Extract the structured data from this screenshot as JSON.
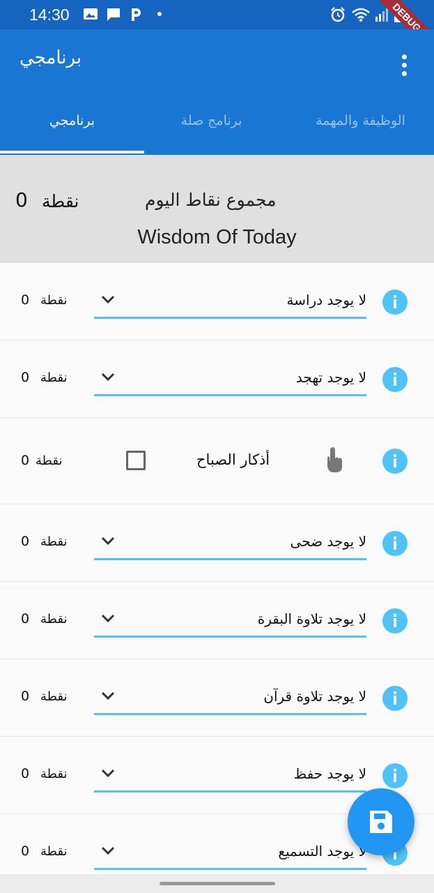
{
  "status_bar": {
    "time": "14:30",
    "icons": [
      "gallery-icon",
      "chat-icon",
      "p-app-icon",
      "dot-icon",
      "alarm-icon",
      "wifi-icon",
      "signal-icon",
      "battery-icon"
    ],
    "debug_label": "DEBUG",
    "colors": {
      "background": "#1565c0"
    }
  },
  "appbar": {
    "title": "برنامجي",
    "menu_icon": "more-vert-icon",
    "colors": {
      "background": "#1976d2"
    },
    "tabs": [
      {
        "label": "الوظيفة والمهمة",
        "active": false
      },
      {
        "label": "برنامج صلة",
        "active": false
      },
      {
        "label": "برنامجي",
        "active": true
      }
    ]
  },
  "summary": {
    "total_points": "0",
    "points_label": "نقطة",
    "title": "مجموع نقاط اليوم",
    "wisdom": "Wisdom Of Today"
  },
  "list": {
    "accent_color": "#4fc3f7",
    "items": [
      {
        "type": "dropdown",
        "value": "لا يوجد دراسة",
        "points": "0",
        "points_label": "نقطة"
      },
      {
        "type": "dropdown",
        "value": "لا يوجد تهجد",
        "points": "0",
        "points_label": "نقطة"
      },
      {
        "type": "checkbox",
        "label": "أذكار الصباح",
        "checked": false,
        "icon": "touch-icon",
        "points": "0",
        "points_label": "نقطة"
      },
      {
        "type": "dropdown",
        "value": "لا يوجد ضحى",
        "points": "0",
        "points_label": "نقطة"
      },
      {
        "type": "dropdown",
        "value": "لا يوجد تلاوة البقرة",
        "points": "0",
        "points_label": "نقطة"
      },
      {
        "type": "dropdown",
        "value": "لا يوجد تلاوة قرآن",
        "points": "0",
        "points_label": "نقطة"
      },
      {
        "type": "dropdown",
        "value": "لا يوجد حفظ",
        "points": "0",
        "points_label": "نقطة"
      },
      {
        "type": "dropdown",
        "value": "لا يوجد التسميع",
        "points": "0",
        "points_label": "نقطة"
      }
    ]
  },
  "fab": {
    "icon": "save-icon",
    "color": "#2196f3"
  }
}
